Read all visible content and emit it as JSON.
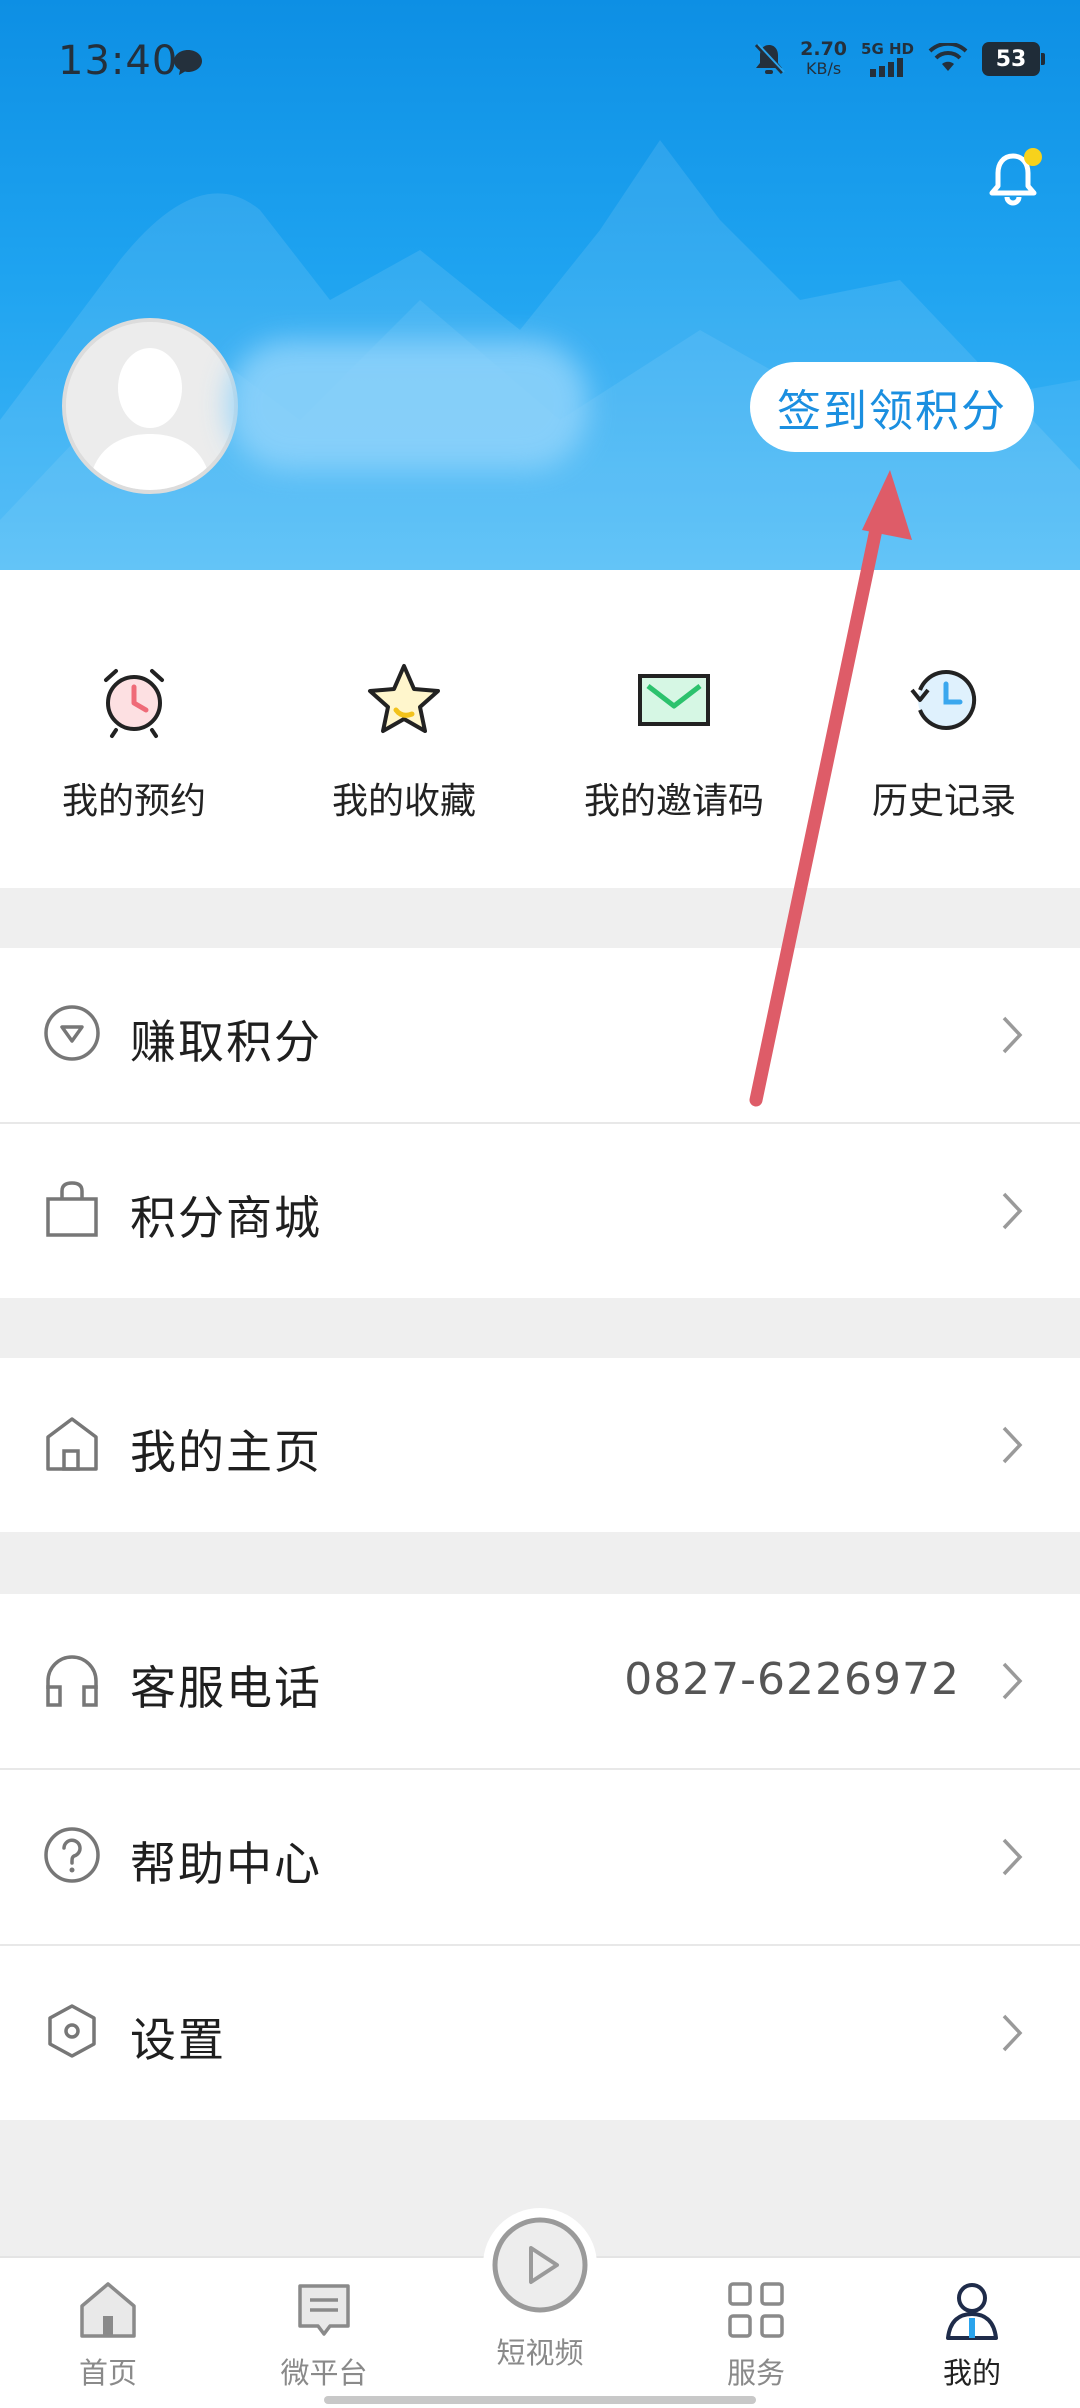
{
  "status_bar": {
    "time": "13:40",
    "net_speed_value": "2.70",
    "net_speed_unit": "KB/s",
    "net_type": "5G HD",
    "battery": "53"
  },
  "header": {
    "checkin_label": "签到领积分",
    "notification_dot_color": "#f7d21c",
    "accent_color": "#1ea3f0"
  },
  "quick_actions": [
    {
      "label": "我的预约",
      "icon": "alarm-clock-icon"
    },
    {
      "label": "我的收藏",
      "icon": "star-icon"
    },
    {
      "label": "我的邀请码",
      "icon": "envelope-icon"
    },
    {
      "label": "历史记录",
      "icon": "history-clock-icon"
    }
  ],
  "menu": {
    "earn_points": {
      "label": "赚取积分",
      "icon": "diamond-icon"
    },
    "points_mall": {
      "label": "积分商城",
      "icon": "shopping-bag-icon"
    },
    "my_homepage": {
      "label": "我的主页",
      "icon": "house-icon"
    },
    "customer_service": {
      "label": "客服电话",
      "value": "0827-6226972",
      "icon": "headset-icon"
    },
    "help_center": {
      "label": "帮助中心",
      "icon": "question-icon"
    },
    "settings": {
      "label": "设置",
      "icon": "hexagon-gear-icon"
    }
  },
  "tabbar": {
    "home": "首页",
    "micro_platform": "微平台",
    "short_video": "短视频",
    "services": "服务",
    "mine": "我的"
  }
}
